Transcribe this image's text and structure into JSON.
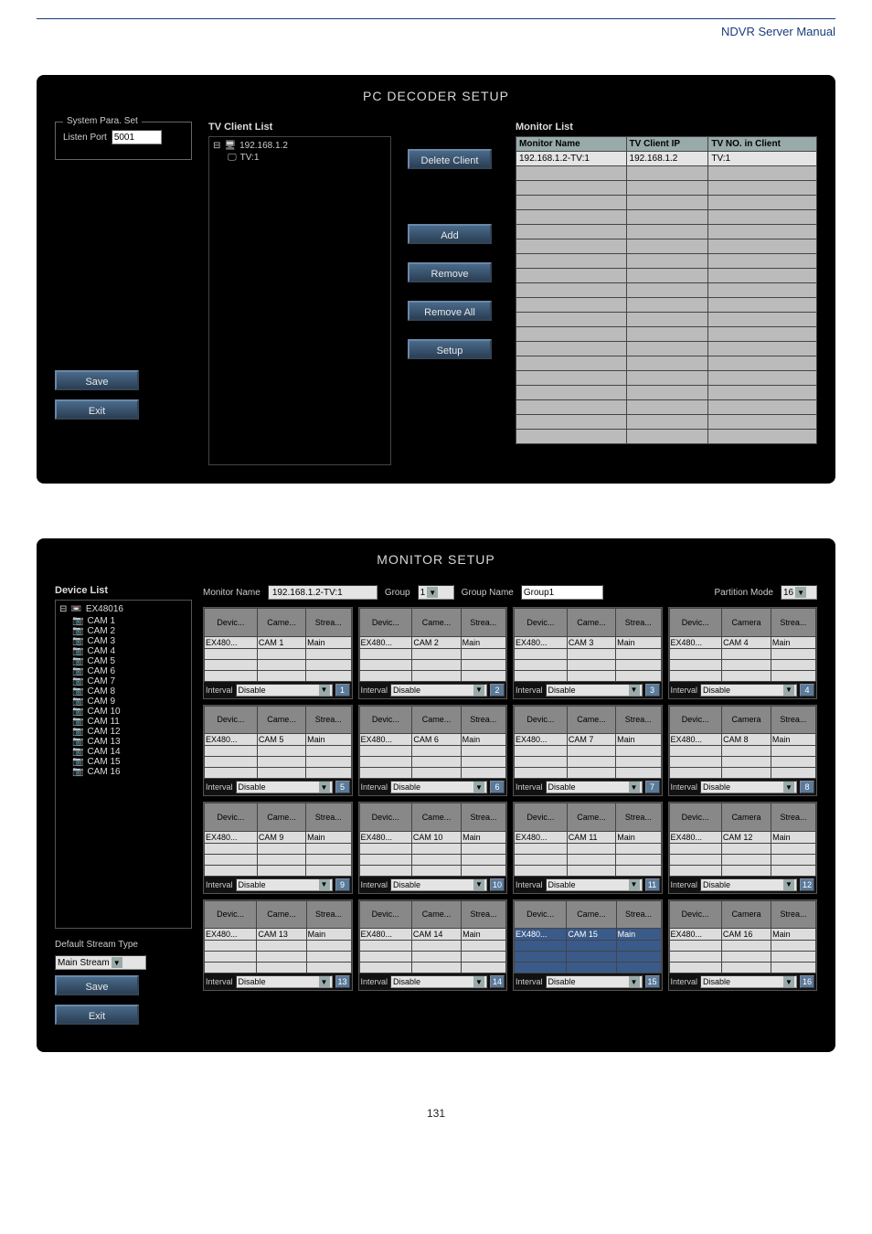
{
  "manual_title": "NDVR Server Manual",
  "page_number": "131",
  "decoder": {
    "title": "PC DECODER SETUP",
    "sys_para_label": "System Para. Set",
    "listen_port_label": "Listen Port",
    "listen_port_value": "5001",
    "save_label": "Save",
    "exit_label": "Exit",
    "tv_client_list_label": "TV Client List",
    "tree_root": "192.168.1.2",
    "tree_child": "TV:1",
    "mid_buttons": {
      "delete_client": "Delete Client",
      "add": "Add",
      "remove": "Remove",
      "remove_all": "Remove All",
      "setup": "Setup"
    },
    "monitor_list_label": "Monitor List",
    "monitor_cols": [
      "Monitor Name",
      "TV Client IP",
      "TV NO. in Client"
    ],
    "monitor_row": [
      "192.168.1.2-TV:1",
      "192.168.1.2",
      "TV:1"
    ]
  },
  "monitorSetup": {
    "title": "MONITOR SETUP",
    "device_list_label": "Device List",
    "monitor_name_label": "Monitor Name",
    "monitor_name_value": "192.168.1.2-TV:1",
    "group_label": "Group",
    "group_value": "1",
    "group_name_label": "Group Name",
    "group_name_value": "Group1",
    "partition_mode_label": "Partition Mode",
    "partition_mode_value": "16",
    "device_root": "EX48016",
    "cams": [
      "CAM 1",
      "CAM 2",
      "CAM 3",
      "CAM 4",
      "CAM 5",
      "CAM 6",
      "CAM 7",
      "CAM 8",
      "CAM 9",
      "CAM 10",
      "CAM 11",
      "CAM 12",
      "CAM 13",
      "CAM 14",
      "CAM 15",
      "CAM 16"
    ],
    "default_stream_type_label": "Default Stream Type",
    "default_stream_type_value": "Main Stream",
    "save_label": "Save",
    "exit_label": "Exit",
    "cell_headers": [
      "Devic...",
      "Came...",
      "Strea..."
    ],
    "cell_headers_alt": [
      "Devic...",
      "Camera",
      "Strea..."
    ],
    "interval_label": "Interval",
    "disable_value": "Disable",
    "cells": [
      {
        "dev": "EX480...",
        "cam": "CAM 1",
        "str": "Main",
        "n": "1"
      },
      {
        "dev": "EX480...",
        "cam": "CAM 2",
        "str": "Main",
        "n": "2"
      },
      {
        "dev": "EX480...",
        "cam": "CAM 3",
        "str": "Main",
        "n": "3"
      },
      {
        "dev": "EX480...",
        "cam": "CAM 4",
        "str": "Main",
        "n": "4",
        "alt": true
      },
      {
        "dev": "EX480...",
        "cam": "CAM 5",
        "str": "Main",
        "n": "5"
      },
      {
        "dev": "EX480...",
        "cam": "CAM 6",
        "str": "Main",
        "n": "6"
      },
      {
        "dev": "EX480...",
        "cam": "CAM 7",
        "str": "Main",
        "n": "7"
      },
      {
        "dev": "EX480...",
        "cam": "CAM 8",
        "str": "Main",
        "n": "8",
        "alt": true
      },
      {
        "dev": "EX480...",
        "cam": "CAM 9",
        "str": "Main",
        "n": "9"
      },
      {
        "dev": "EX480...",
        "cam": "CAM 10",
        "str": "Main",
        "n": "10"
      },
      {
        "dev": "EX480...",
        "cam": "CAM 11",
        "str": "Main",
        "n": "11"
      },
      {
        "dev": "EX480...",
        "cam": "CAM 12",
        "str": "Main",
        "n": "12",
        "alt": true
      },
      {
        "dev": "EX480...",
        "cam": "CAM 13",
        "str": "Main",
        "n": "13"
      },
      {
        "dev": "EX480...",
        "cam": "CAM 14",
        "str": "Main",
        "n": "14"
      },
      {
        "dev": "EX480...",
        "cam": "CAM 15",
        "str": "Main",
        "n": "15",
        "sel": true
      },
      {
        "dev": "EX480...",
        "cam": "CAM 16",
        "str": "Main",
        "n": "16",
        "alt": true
      }
    ]
  }
}
